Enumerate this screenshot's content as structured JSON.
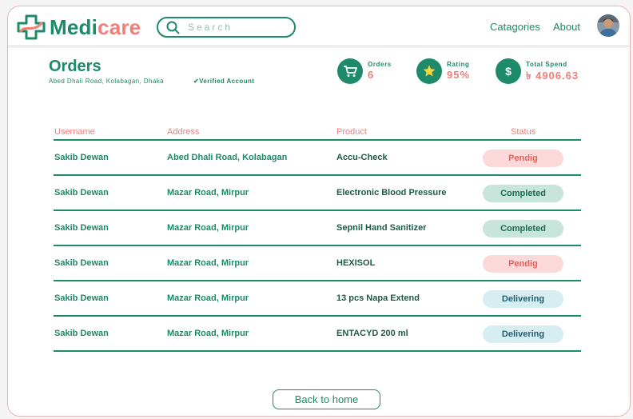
{
  "brand": {
    "part1": "Medi",
    "part2": "care"
  },
  "search": {
    "placeholder": "Search"
  },
  "nav": {
    "categories": "Catagories",
    "about": "About"
  },
  "orders_header": {
    "title": "Orders",
    "address": "Abed Dhali Road, Kolabagan, Dhaka",
    "verified": "✔Verified Account"
  },
  "stats": {
    "orders": {
      "label": "Orders",
      "value": "6"
    },
    "rating": {
      "label": "Rating",
      "value": "95%"
    },
    "spend": {
      "label": "Total Spend",
      "value": "৳ 4906.63"
    }
  },
  "table": {
    "headers": {
      "username": "Username",
      "address": "Address",
      "product": "Product",
      "status": "Status"
    },
    "rows": [
      {
        "username": "Sakib Dewan",
        "address": "Abed Dhali Road, Kolabagan",
        "product": "Accu-Check",
        "status": "Pendig"
      },
      {
        "username": "Sakib Dewan",
        "address": "Mazar Road, Mirpur",
        "product": "Electronic Blood Pressure",
        "status": "Completed"
      },
      {
        "username": "Sakib Dewan",
        "address": "Mazar Road, Mirpur",
        "product": "Sepnil Hand Sanitizer",
        "status": "Completed"
      },
      {
        "username": "Sakib Dewan",
        "address": "Mazar Road, Mirpur",
        "product": "HEXISOL",
        "status": "Pendig"
      },
      {
        "username": "Sakib Dewan",
        "address": "Mazar Road, Mirpur",
        "product": "13 pcs Napa Extend",
        "status": "Delivering"
      },
      {
        "username": "Sakib Dewan",
        "address": "Mazar Road, Mirpur",
        "product": "ENTACYD 200 ml",
        "status": "Delivering"
      }
    ]
  },
  "footer": {
    "back_label": "Back to home"
  },
  "colors": {
    "primary": "#1d8a6a",
    "accent": "#f07f78",
    "pending_bg": "#fcd9d9",
    "completed_bg": "#c7e5db",
    "delivering_bg": "#d6edf2"
  },
  "icons": {
    "logo": "medical-cross-icon",
    "search": "search-icon",
    "orders": "cart-icon",
    "rating": "star-icon",
    "spend": "dollar-icon"
  }
}
